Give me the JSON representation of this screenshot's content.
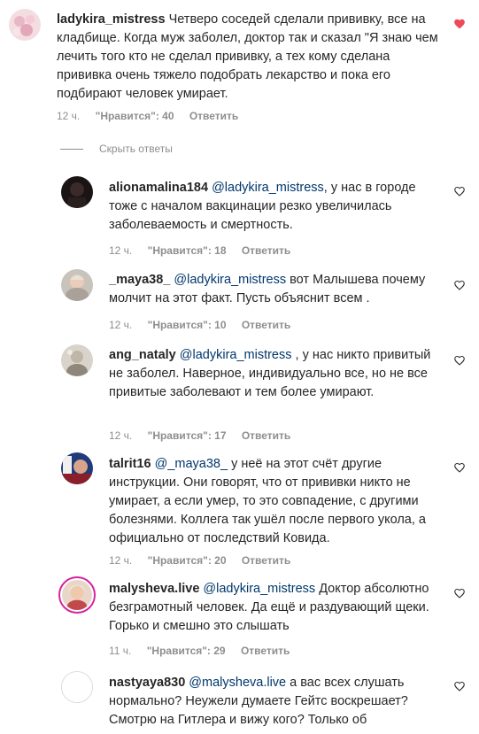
{
  "main_comment": {
    "username": "ladykira_mistress",
    "text": "Четверо соседей сделали прививку, все на кладбище. Когда муж заболел, доктор так и сказал \"Я знаю чем лечить того кто не сделал прививку, а тех кому сделана прививка очень тяжело подобрать лекарство и пока его подбирают человек умирает.",
    "time": "12 ч.",
    "likes": "\"Нравится\": 40",
    "reply": "Ответить",
    "liked": true
  },
  "hide_replies_label": "Скрыть ответы",
  "replies": [
    {
      "username": "alionamalina184",
      "mention": "@ladykira_mistress",
      "text": ", у нас в городе тоже с началом вакцинации резко увеличилась заболеваемость и смертность.",
      "time": "12 ч.",
      "likes": "\"Нравится\": 18",
      "reply": "Ответить"
    },
    {
      "username": "_maya38_",
      "mention": "@ladykira_mistress",
      "text": "вот Малышева почему молчит на этот факт. Пусть объяснит всем .",
      "time": "12 ч.",
      "likes": "\"Нравится\": 10",
      "reply": "Ответить"
    },
    {
      "username": "ang_nataly",
      "mention": "@ladykira_mistress",
      "text": ", у нас никто привитый не заболел. Наверное, индивидуально все, но не все привитые заболевают и тем более умирают.",
      "time": "12 ч.",
      "likes": "\"Нравится\": 17",
      "reply": "Ответить"
    },
    {
      "username": "talrit16",
      "mention": "@_maya38_",
      "text": "у неё на этот счёт другие инструкции. Они говорят, что от прививки никто не умирает, а если умер, то это совпадение, с другими болезнями. Коллега так ушёл после первого укола, а официально от последствий Ковида.",
      "time": "12 ч.",
      "likes": "\"Нравится\": 20",
      "reply": "Ответить"
    },
    {
      "username": "malysheva.live",
      "mention": "@ladykira_mistress",
      "text": "Доктор абсолютно безграмотный человек. Да ещё и раздувающий щеки. Горько и смешно это слышать",
      "time": "11 ч.",
      "likes": "\"Нравится\": 29",
      "reply": "Ответить"
    },
    {
      "username": "nastyaya830",
      "mention": "@malysheva.live",
      "text": "а вас всех слушать нормально? Неужели думаете Гейтс воскрешает? Смотрю на Гитлера и вижу кого? Только об"
    }
  ],
  "colors": {
    "text": "#262626",
    "meta": "#8e8e8e",
    "mention": "#00376b",
    "heart_liked": "#ed4956"
  },
  "icons": {
    "like": "heart-outline-icon",
    "liked": "heart-filled-icon"
  }
}
